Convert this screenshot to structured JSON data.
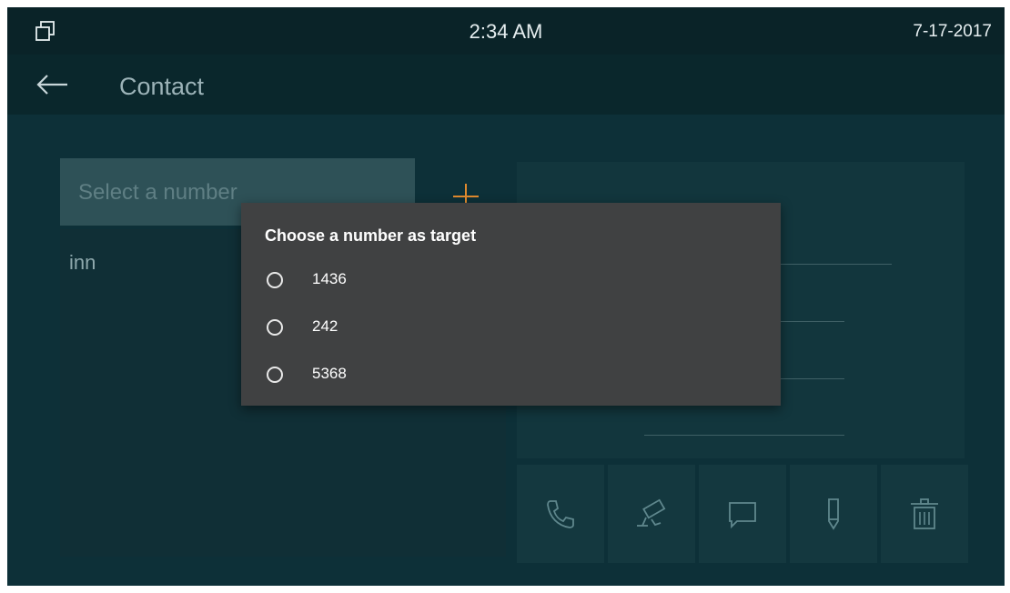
{
  "status": {
    "time": "2:34 AM",
    "date": "7-17-2017"
  },
  "header": {
    "title": "Contact"
  },
  "select": {
    "placeholder": "Select a number"
  },
  "contacts": [
    {
      "name": "inn"
    }
  ],
  "dialog": {
    "title": "Choose a number as target",
    "options": [
      {
        "label": "1436",
        "selected": false
      },
      {
        "label": "242",
        "selected": false
      },
      {
        "label": "5368",
        "selected": false
      }
    ]
  },
  "actions": [
    "call",
    "monitor",
    "message",
    "edit",
    "delete"
  ],
  "icons": {
    "multi_window": "multi-window-icon",
    "back": "back-arrow-icon",
    "add": "plus-icon",
    "call": "phone-icon",
    "monitor": "camera-icon",
    "message": "message-icon",
    "edit": "pencil-icon",
    "delete": "trash-icon"
  },
  "colors": {
    "background": "#0c2d33",
    "accent": "#e08a2e",
    "dialog": "#404142"
  }
}
